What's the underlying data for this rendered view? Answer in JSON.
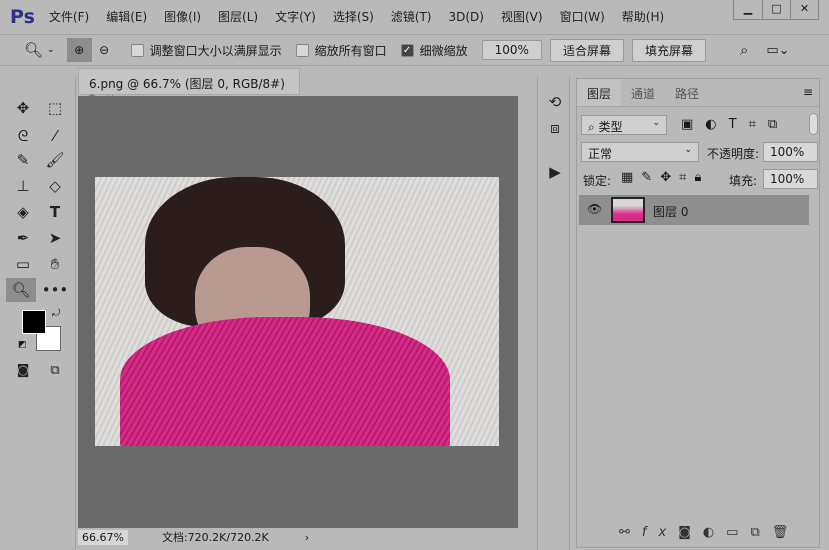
{
  "app": {
    "logo": "Ps"
  },
  "menu": [
    "文件(F)",
    "编辑(E)",
    "图像(I)",
    "图层(L)",
    "文字(Y)",
    "选择(S)",
    "滤镜(T)",
    "3D(D)",
    "视图(V)",
    "窗口(W)",
    "帮助(H)"
  ],
  "window_controls": {
    "minimize": "▁",
    "maximize": "□",
    "close": "✕"
  },
  "options": {
    "resize_windows": "调整窗口大小以满屏显示",
    "zoom_all": "缩放所有窗口",
    "scrubby_zoom": "细微缩放",
    "scrubby_checked": true,
    "btn_100": "100%",
    "btn_fit": "适合屏幕",
    "btn_fill": "填充屏幕"
  },
  "document": {
    "tab_title": "6.png @ 66.7% (图层 0, RGB/8#) *",
    "close": "×",
    "zoom": "66.67%",
    "doc_size": "文档:720.2K/720.2K",
    "arrow": "›"
  },
  "panel": {
    "tabs": [
      "图层",
      "通道",
      "路径"
    ],
    "filter_kind": "类型",
    "blend_mode": "正常",
    "opacity_label": "不透明度:",
    "opacity": "100%",
    "lock_label": "锁定:",
    "fill_label": "填充:",
    "fill": "100%",
    "layer_name": "图层 0"
  },
  "colors": {
    "foreground": "#000000",
    "background": "#ffffff"
  }
}
